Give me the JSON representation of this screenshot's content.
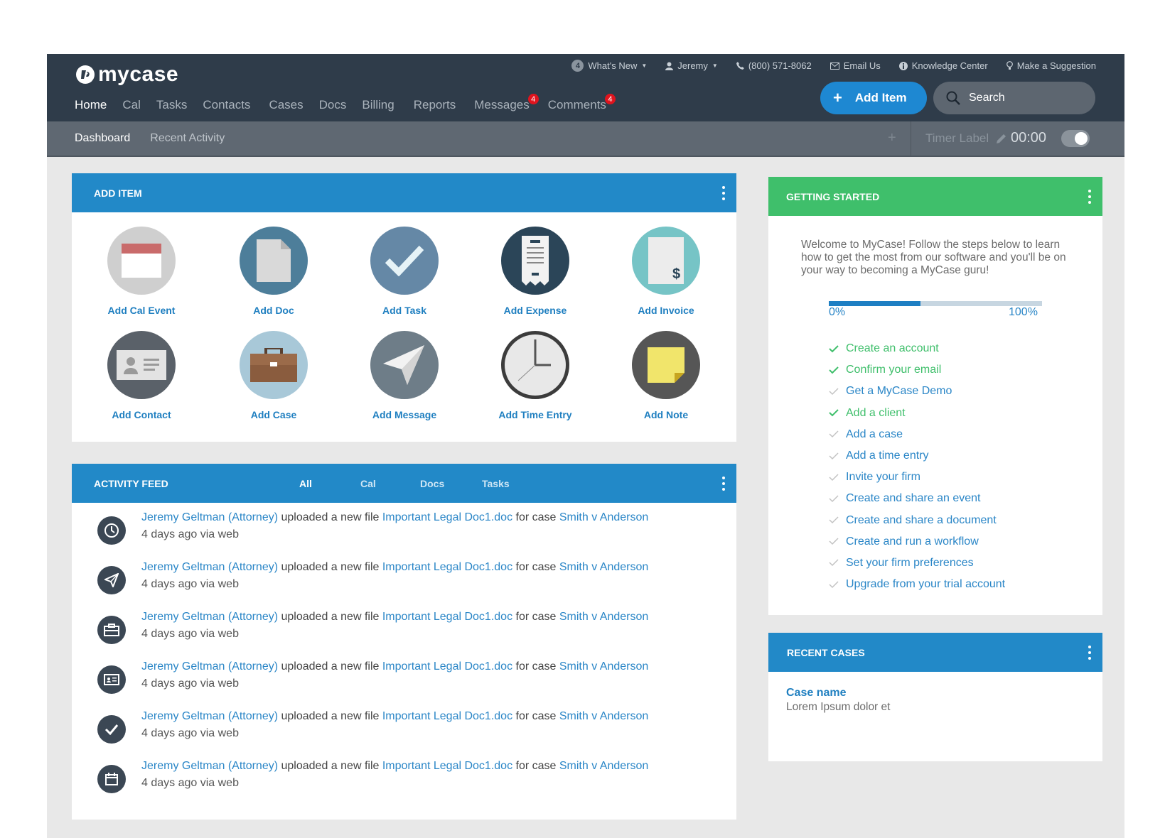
{
  "brand": {
    "name": "mycase"
  },
  "utility": {
    "whats_new_count": "4",
    "whats_new": "What's New",
    "user": "Jeremy",
    "phone": "(800) 571-8062",
    "email": "Email Us",
    "knowledge": "Knowledge Center",
    "suggestion": "Make a Suggestion"
  },
  "main_nav": [
    {
      "label": "Home",
      "active": true
    },
    {
      "label": "Cal"
    },
    {
      "label": "Tasks"
    },
    {
      "label": "Contacts"
    },
    {
      "label": "Cases"
    },
    {
      "label": "Docs"
    },
    {
      "label": "Billing"
    },
    {
      "label": "Reports"
    },
    {
      "label": "Messages",
      "badge": "4"
    },
    {
      "label": "Comments",
      "badge": "4"
    }
  ],
  "add_item_button": "Add Item",
  "search": {
    "placeholder": "Search"
  },
  "sub_nav": [
    {
      "label": "Dashboard",
      "active": true
    },
    {
      "label": "Recent Activity"
    }
  ],
  "timer": {
    "add": "+",
    "label": "Timer Label",
    "time": "00:00",
    "running": false
  },
  "add_item_panel": {
    "title": "ADD ITEM",
    "tiles": [
      {
        "label": "Add Cal Event",
        "icon": "calendar-icon"
      },
      {
        "label": "Add Doc",
        "icon": "document-icon"
      },
      {
        "label": "Add Task",
        "icon": "checkmark-icon"
      },
      {
        "label": "Add Expense",
        "icon": "receipt-icon"
      },
      {
        "label": "Add Invoice",
        "icon": "invoice-icon"
      },
      {
        "label": "Add Contact",
        "icon": "contact-card-icon"
      },
      {
        "label": "Add Case",
        "icon": "briefcase-icon"
      },
      {
        "label": "Add Message",
        "icon": "paper-plane-icon"
      },
      {
        "label": "Add Time Entry",
        "icon": "clock-icon"
      },
      {
        "label": "Add Note",
        "icon": "sticky-note-icon"
      }
    ]
  },
  "activity_feed": {
    "title": "ACTIVITY FEED",
    "tabs": [
      {
        "label": "All",
        "active": true
      },
      {
        "label": "Cal"
      },
      {
        "label": "Docs"
      },
      {
        "label": "Tasks"
      }
    ],
    "items": [
      {
        "icon": "clock-icon",
        "user": "Jeremy Geltman (Attorney)",
        "action": " uploaded a new file ",
        "file": "Important Legal Doc1.doc",
        "for_case": " for case ",
        "case": "Smith v Anderson",
        "meta": "4 days ago via web"
      },
      {
        "icon": "paper-plane-icon",
        "user": "Jeremy Geltman (Attorney)",
        "action": " uploaded a new file ",
        "file": "Important Legal Doc1.doc",
        "for_case": " for case ",
        "case": "Smith v Anderson",
        "meta": "4 days ago via web"
      },
      {
        "icon": "briefcase-icon",
        "user": "Jeremy Geltman (Attorney)",
        "action": " uploaded a new file ",
        "file": "Important Legal Doc1.doc",
        "for_case": " for case ",
        "case": "Smith v Anderson",
        "meta": "4 days ago via web"
      },
      {
        "icon": "contact-card-icon",
        "user": "Jeremy Geltman (Attorney)",
        "action": " uploaded a new file ",
        "file": "Important Legal Doc1.doc",
        "for_case": " for case ",
        "case": "Smith v Anderson",
        "meta": "4 days ago via web"
      },
      {
        "icon": "checkmark-icon",
        "user": "Jeremy Geltman (Attorney)",
        "action": " uploaded a new file ",
        "file": "Important Legal Doc1.doc",
        "for_case": " for case ",
        "case": "Smith v Anderson",
        "meta": "4 days ago via web"
      },
      {
        "icon": "calendar-icon",
        "user": "Jeremy Geltman (Attorney)",
        "action": " uploaded a new file ",
        "file": "Important Legal Doc1.doc",
        "for_case": " for case ",
        "case": "Smith v Anderson",
        "meta": "4 days ago via web"
      }
    ]
  },
  "getting_started": {
    "title": "GETTING STARTED",
    "intro": "Welcome to MyCase! Follow the steps below to learn how to get the most from our software and you'll be on your way to becoming a MyCase guru!",
    "progress": 0.43,
    "progress_min": "0%",
    "progress_max": "100%",
    "steps": [
      {
        "label": "Create an account",
        "done": true
      },
      {
        "label": "Confirm your email",
        "done": true
      },
      {
        "label": "Get a MyCase Demo",
        "done": false
      },
      {
        "label": "Add a client",
        "done": true
      },
      {
        "label": "Add a case",
        "done": false
      },
      {
        "label": "Add a time entry",
        "done": false
      },
      {
        "label": "Invite your firm",
        "done": false
      },
      {
        "label": "Create and share an event",
        "done": false
      },
      {
        "label": "Create and share a document",
        "done": false
      },
      {
        "label": "Create and run a workflow",
        "done": false
      },
      {
        "label": "Set your firm preferences",
        "done": false
      },
      {
        "label": "Upgrade from your trial account",
        "done": false
      }
    ]
  },
  "recent_cases": {
    "title": "RECENT CASES",
    "case_name": "Case name",
    "case_desc": "Lorem Ipsum dolor et"
  },
  "colors": {
    "header": "#2f3c4a",
    "subheader": "#5f6872",
    "primary_blue": "#2289c8",
    "accent_green": "#3fbf6b",
    "badge_red": "#e0141e"
  }
}
